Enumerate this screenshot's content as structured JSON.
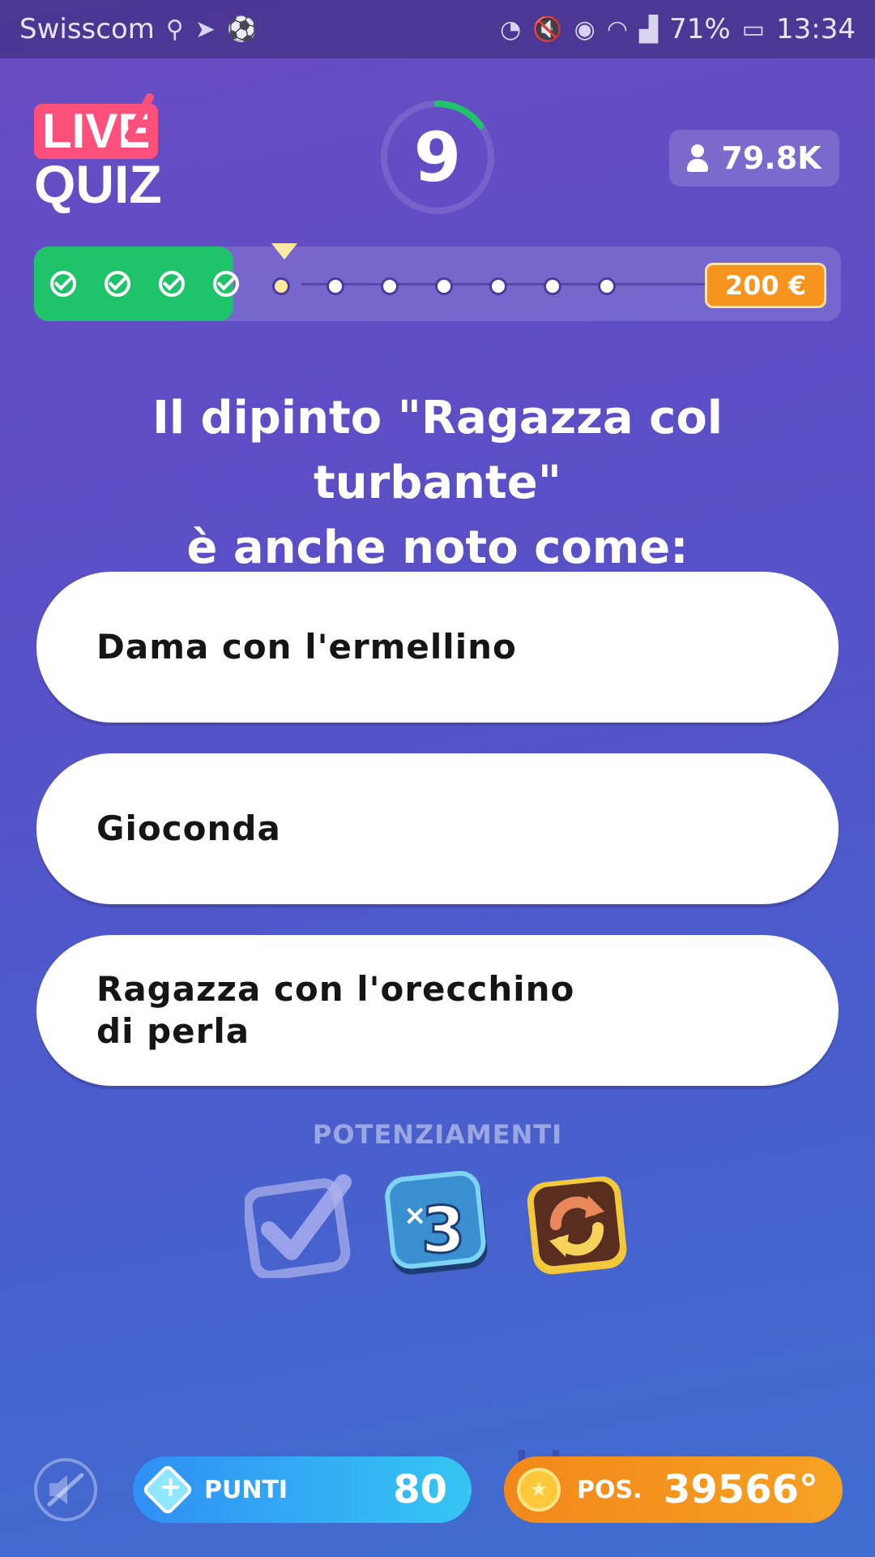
{
  "status_bar": {
    "carrier": "Swisscom",
    "battery": "71%",
    "time": "13:34"
  },
  "header": {
    "logo_top": "LIVE",
    "logo_bottom": "QUIZ",
    "timer": "9",
    "timer_progress_fraction": 0.15,
    "viewers": "79.8K"
  },
  "progress": {
    "answered": 4,
    "total": 12,
    "prize": "200 €"
  },
  "question": {
    "line1": "Il dipinto \"Ragazza col turbante\"",
    "line2": "è anche noto come:"
  },
  "answers": [
    {
      "text": "Dama con l'ermellino"
    },
    {
      "text": "Gioconda"
    },
    {
      "text": "Ragazza con l'orecchino di perla"
    }
  ],
  "powerups": {
    "title": "POTENZIAMENTI",
    "items": [
      "checkmark-powerup-icon",
      "times-three-powerup-icon",
      "refresh-powerup-icon"
    ]
  },
  "bottom": {
    "points_label": "PUNTI",
    "points_value": "80",
    "position_label": "POS.",
    "position_value": "39566°"
  },
  "colors": {
    "correct_green": "#1fc46a",
    "prize_orange": "#f7941d",
    "live_pink": "#ff4f7b"
  }
}
